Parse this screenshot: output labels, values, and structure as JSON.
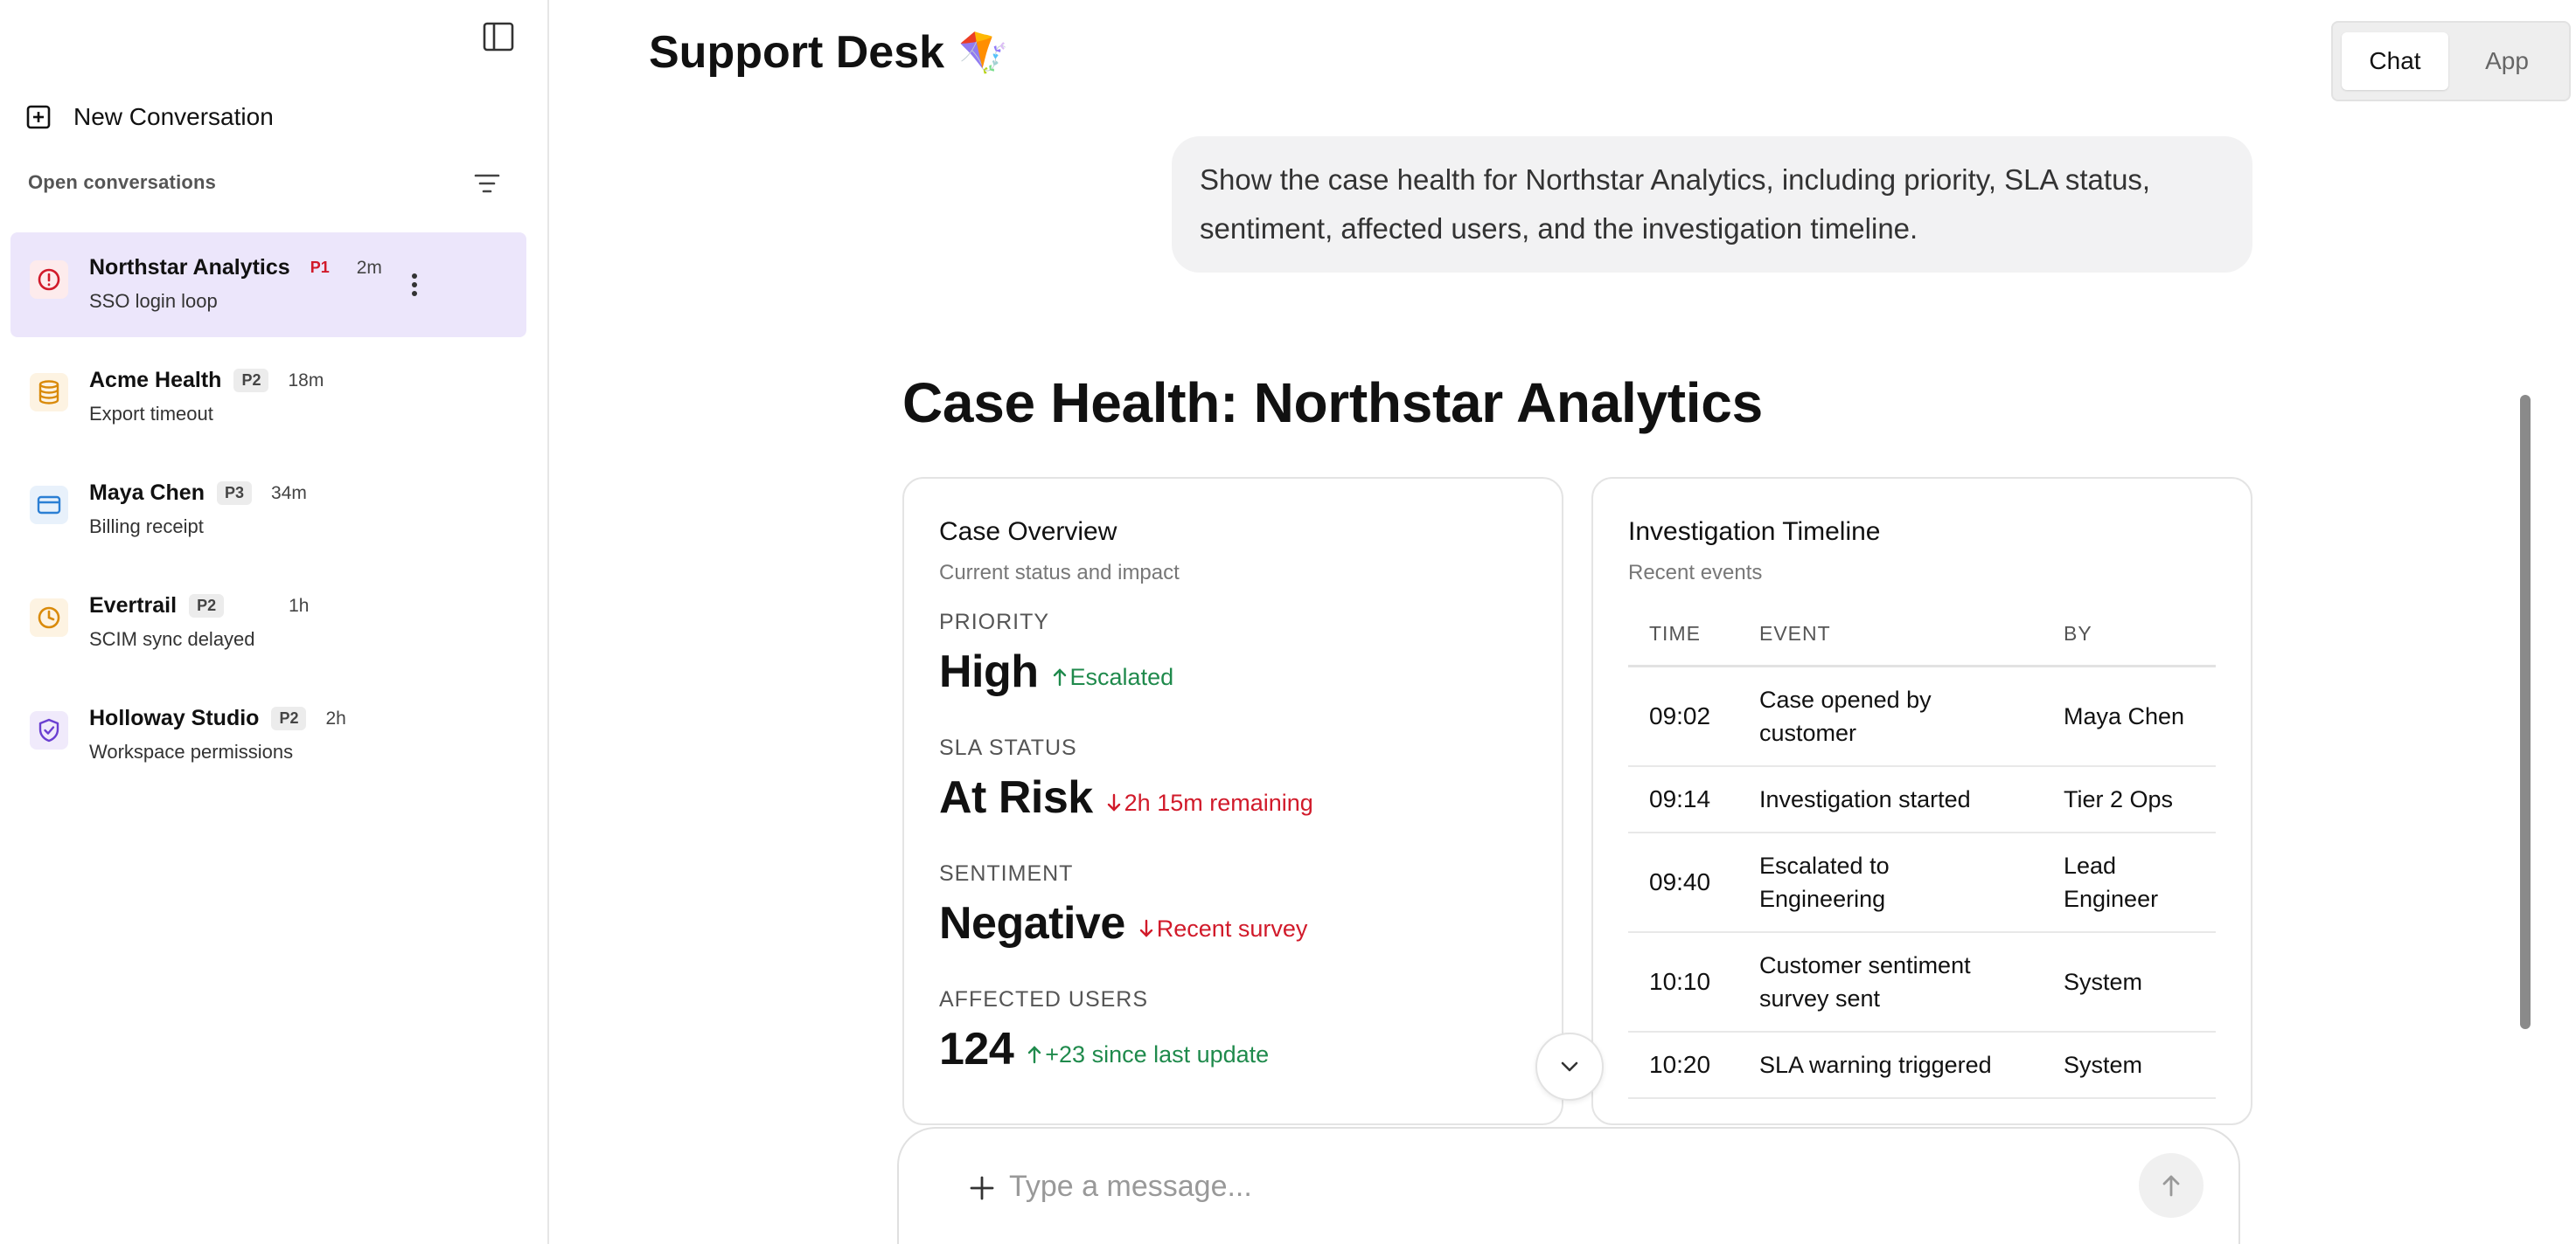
{
  "sidebar": {
    "new_conversation_label": "New Conversation",
    "open_conversations_label": "Open conversations",
    "items": [
      {
        "title": "Northstar Analytics",
        "priority": "P1",
        "time": "2m",
        "subtitle": "SSO login loop",
        "icon": "alert-circle-icon",
        "active": true
      },
      {
        "title": "Acme Health",
        "priority": "P2",
        "time": "18m",
        "subtitle": "Export timeout",
        "icon": "database-icon",
        "active": false
      },
      {
        "title": "Maya Chen",
        "priority": "P3",
        "time": "34m",
        "subtitle": "Billing receipt",
        "icon": "credit-card-icon",
        "active": false
      },
      {
        "title": "Evertrail",
        "priority": "P2",
        "time": "1h",
        "subtitle": "SCIM sync delayed",
        "icon": "clock-icon",
        "active": false
      },
      {
        "title": "Holloway Studio",
        "priority": "P2",
        "time": "2h",
        "subtitle": "Workspace permissions",
        "icon": "shield-check-icon",
        "active": false
      }
    ]
  },
  "header": {
    "title": "Support Desk",
    "title_emoji": "🪁",
    "toggle": {
      "chat": "Chat",
      "app": "App",
      "selected": "Chat"
    }
  },
  "chat": {
    "user_message": "Show the case health for Northstar Analytics, including priority, SLA status, sentiment, affected users, and the investigation timeline.",
    "case_title_prefix": "Case Health: ",
    "case_title_name": "Northstar Analytics"
  },
  "overview": {
    "title": "Case Overview",
    "subtitle": "Current status and impact",
    "metrics": [
      {
        "label": "PRIORITY",
        "value": "High",
        "delta": "Escalated",
        "direction": "up"
      },
      {
        "label": "SLA STATUS",
        "value": "At Risk",
        "delta": "2h 15m remaining",
        "direction": "down"
      },
      {
        "label": "SENTIMENT",
        "value": "Negative",
        "delta": "Recent survey",
        "direction": "down"
      },
      {
        "label": "AFFECTED USERS",
        "value": "124",
        "delta": "+23 since last update",
        "direction": "up"
      }
    ]
  },
  "timeline": {
    "title": "Investigation Timeline",
    "subtitle": "Recent events",
    "columns": [
      "TIME",
      "EVENT",
      "BY"
    ],
    "rows": [
      {
        "time": "09:02",
        "event": "Case opened by customer",
        "by": "Maya Chen"
      },
      {
        "time": "09:14",
        "event": "Investigation started",
        "by": "Tier 2 Ops"
      },
      {
        "time": "09:40",
        "event": "Escalated to Engineering",
        "by": "Lead Engineer"
      },
      {
        "time": "10:10",
        "event": "Customer sentiment survey sent",
        "by": "System"
      },
      {
        "time": "10:20",
        "event": "SLA warning triggered",
        "by": "System"
      }
    ]
  },
  "composer": {
    "placeholder": "Type a message..."
  },
  "colors": {
    "active_item_bg": "#ece6fb",
    "p1": "#d11a2a",
    "delta_up": "#1f8a4c",
    "delta_down": "#d11a2a",
    "icon_red": "#d11a2a",
    "icon_orange": "#d98a0a",
    "icon_blue": "#2b7fd4",
    "icon_purple": "#6a3fd1"
  }
}
